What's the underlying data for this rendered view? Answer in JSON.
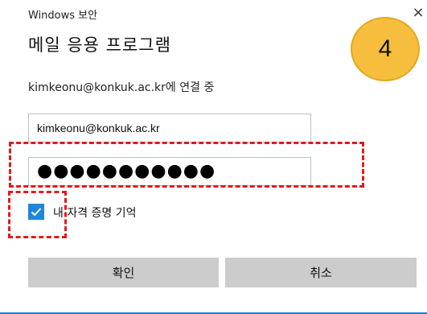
{
  "window": {
    "app_title": "Windows 보안",
    "close_glyph": "×",
    "dialog_title": "메일 응용 프로그램",
    "connecting_text": "kimkeonu@konkuk.ac.kr에 연결 중"
  },
  "form": {
    "email_value": "kimkeonu@konkuk.ac.kr",
    "password_masked": "●●●●●●●●●●●",
    "remember_label": "내 자격 증명 기억",
    "remember_checked": true
  },
  "buttons": {
    "ok_label": "확인",
    "cancel_label": "취소"
  },
  "annotation": {
    "step_number": "4",
    "badge_color": "#f6be3c",
    "highlight_color": "#e21a1a"
  },
  "colors": {
    "accent": "#1f86dd",
    "button_bg": "#cccccc"
  },
  "icons": {
    "close": "close-icon",
    "check": "checkmark-icon"
  }
}
